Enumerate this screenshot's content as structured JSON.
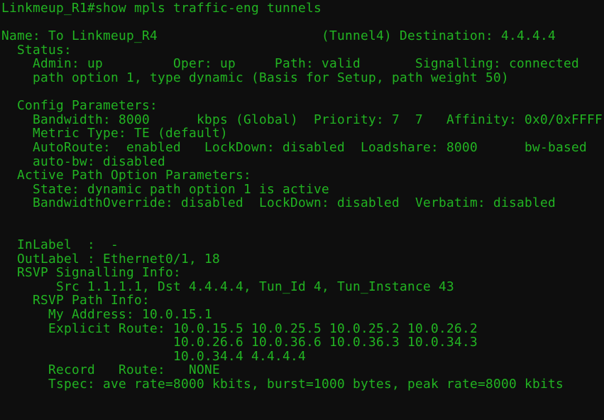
{
  "terminal": {
    "app": "terminal-emulator",
    "colors": {
      "background": "#0e0e0e",
      "foreground": "#22b422",
      "prompt": "#22b422"
    },
    "hostname": "Linkmeup_R1",
    "prompt_symbol": "#",
    "command": "show mpls traffic-eng tunnels",
    "prompt_line": "Linkmeup_R1#show mpls traffic-eng tunnels",
    "tunnel": {
      "name": "To Linkmeup_R4",
      "interface": "Tunnel4",
      "destination": "4.4.4.4",
      "status": {
        "admin": "up",
        "oper": "up",
        "path": "valid",
        "signalling": "connected",
        "path_option": "path option 1, type dynamic (Basis for Setup, path weight 50)"
      },
      "config_parameters": {
        "bandwidth": "8000",
        "bandwidth_units": "kbps (Global)",
        "priority": "7  7",
        "affinity": "0x0/0xFFFF",
        "metric_type": "TE (default)",
        "autoroute": "enabled",
        "lockdown": "disabled",
        "loadshare": "8000",
        "loadshare_mode": "bw-based",
        "auto_bw": "disabled"
      },
      "active_path_option_parameters": {
        "state": "dynamic path option 1 is active",
        "bandwidth_override": "disabled",
        "lockdown": "disabled",
        "verbatim": "disabled"
      },
      "in_label": "-",
      "out_label": "Ethernet0/1, 18",
      "rsvp_signalling_info": {
        "src": "1.1.1.1",
        "dst": "4.4.4.4",
        "tun_id": "4",
        "tun_instance": "43"
      },
      "rsvp_path_info": {
        "my_address": "10.0.15.1",
        "explicit_route": [
          "10.0.15.5 10.0.25.5 10.0.25.2 10.0.26.2",
          "10.0.26.6 10.0.36.6 10.0.36.3 10.0.34.3",
          "10.0.34.4 4.4.4.4"
        ],
        "record_route": "NONE",
        "tspec": "ave rate=8000 kbits, burst=1000 bytes, peak rate=8000 kbits"
      }
    },
    "lines": [
      "Linkmeup_R1#show mpls traffic-eng tunnels",
      "",
      "Name: To Linkmeup_R4                     (Tunnel4) Destination: 4.4.4.4",
      "  Status:",
      "    Admin: up         Oper: up     Path: valid       Signalling: connected",
      "    path option 1, type dynamic (Basis for Setup, path weight 50)",
      "",
      "  Config Parameters:",
      "    Bandwidth: 8000      kbps (Global)  Priority: 7  7   Affinity: 0x0/0xFFFF",
      "    Metric Type: TE (default)",
      "    AutoRoute:  enabled   LockDown: disabled  Loadshare: 8000      bw-based",
      "    auto-bw: disabled",
      "  Active Path Option Parameters:",
      "    State: dynamic path option 1 is active",
      "    BandwidthOverride: disabled  LockDown: disabled  Verbatim: disabled",
      "",
      "",
      "  InLabel  :  -",
      "  OutLabel : Ethernet0/1, 18",
      "  RSVP Signalling Info:",
      "       Src 1.1.1.1, Dst 4.4.4.4, Tun_Id 4, Tun_Instance 43",
      "    RSVP Path Info:",
      "      My Address: 10.0.15.1",
      "      Explicit Route: 10.0.15.5 10.0.25.5 10.0.25.2 10.0.26.2",
      "                      10.0.26.6 10.0.36.6 10.0.36.3 10.0.34.3",
      "                      10.0.34.4 4.4.4.4",
      "      Record   Route:   NONE",
      "      Tspec: ave rate=8000 kbits, burst=1000 bytes, peak rate=8000 kbits"
    ]
  }
}
